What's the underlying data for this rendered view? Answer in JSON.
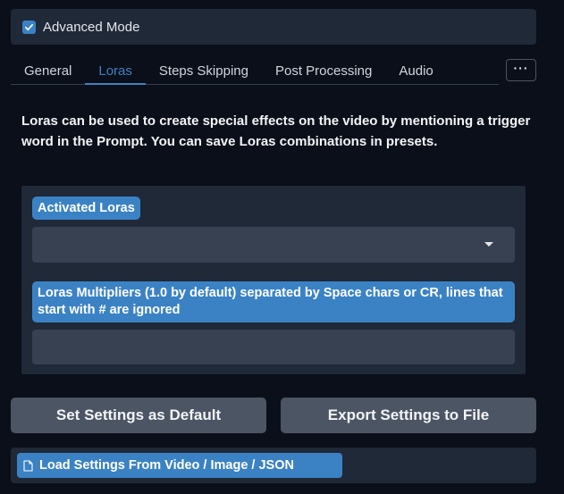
{
  "advanced_mode": {
    "label": "Advanced Mode",
    "checked": true
  },
  "tabs": [
    {
      "label": "General",
      "active": false
    },
    {
      "label": "Loras",
      "active": true
    },
    {
      "label": "Steps Skipping",
      "active": false
    },
    {
      "label": "Post Processing",
      "active": false
    },
    {
      "label": "Audio",
      "active": false
    }
  ],
  "more_button": {
    "label": "···"
  },
  "description": "Loras can be used to create special effects on the video by mentioning a trigger word in the Prompt. You can save Loras combinations in presets.",
  "lora_panel": {
    "activated_label": "Activated Loras",
    "activated_value": "",
    "multipliers_label": "Loras Multipliers (1.0 by default) separated by Space chars or CR, lines that start with # are ignored",
    "multipliers_value": ""
  },
  "buttons": {
    "set_default": "Set Settings as Default",
    "export": "Export Settings to File",
    "load": "Load Settings From Video / Image / JSON"
  },
  "colors": {
    "accent": "#3b82c4",
    "background": "#0b0f19",
    "panel": "#1f2937",
    "button": "#4b5563"
  },
  "icons": {
    "checkbox": "check-icon",
    "dropdown": "chevron-down-icon",
    "load": "file-icon",
    "more": "ellipsis-icon"
  }
}
